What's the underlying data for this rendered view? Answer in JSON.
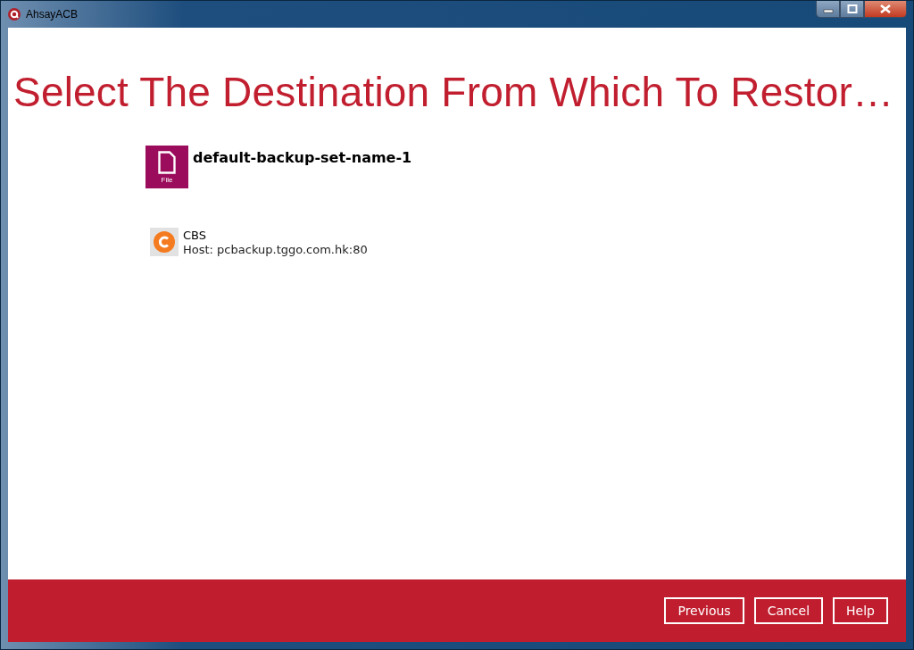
{
  "window": {
    "title": "AhsayACB"
  },
  "heading": "Select The Destination From Which To Restor…",
  "backup_set": {
    "name": "default-backup-set-name-1",
    "icon_label": "File"
  },
  "destinations": [
    {
      "name": "CBS",
      "host": "Host: pcbackup.tggo.com.hk:80"
    }
  ],
  "buttons": [
    "Previous",
    "Cancel",
    "Help"
  ]
}
